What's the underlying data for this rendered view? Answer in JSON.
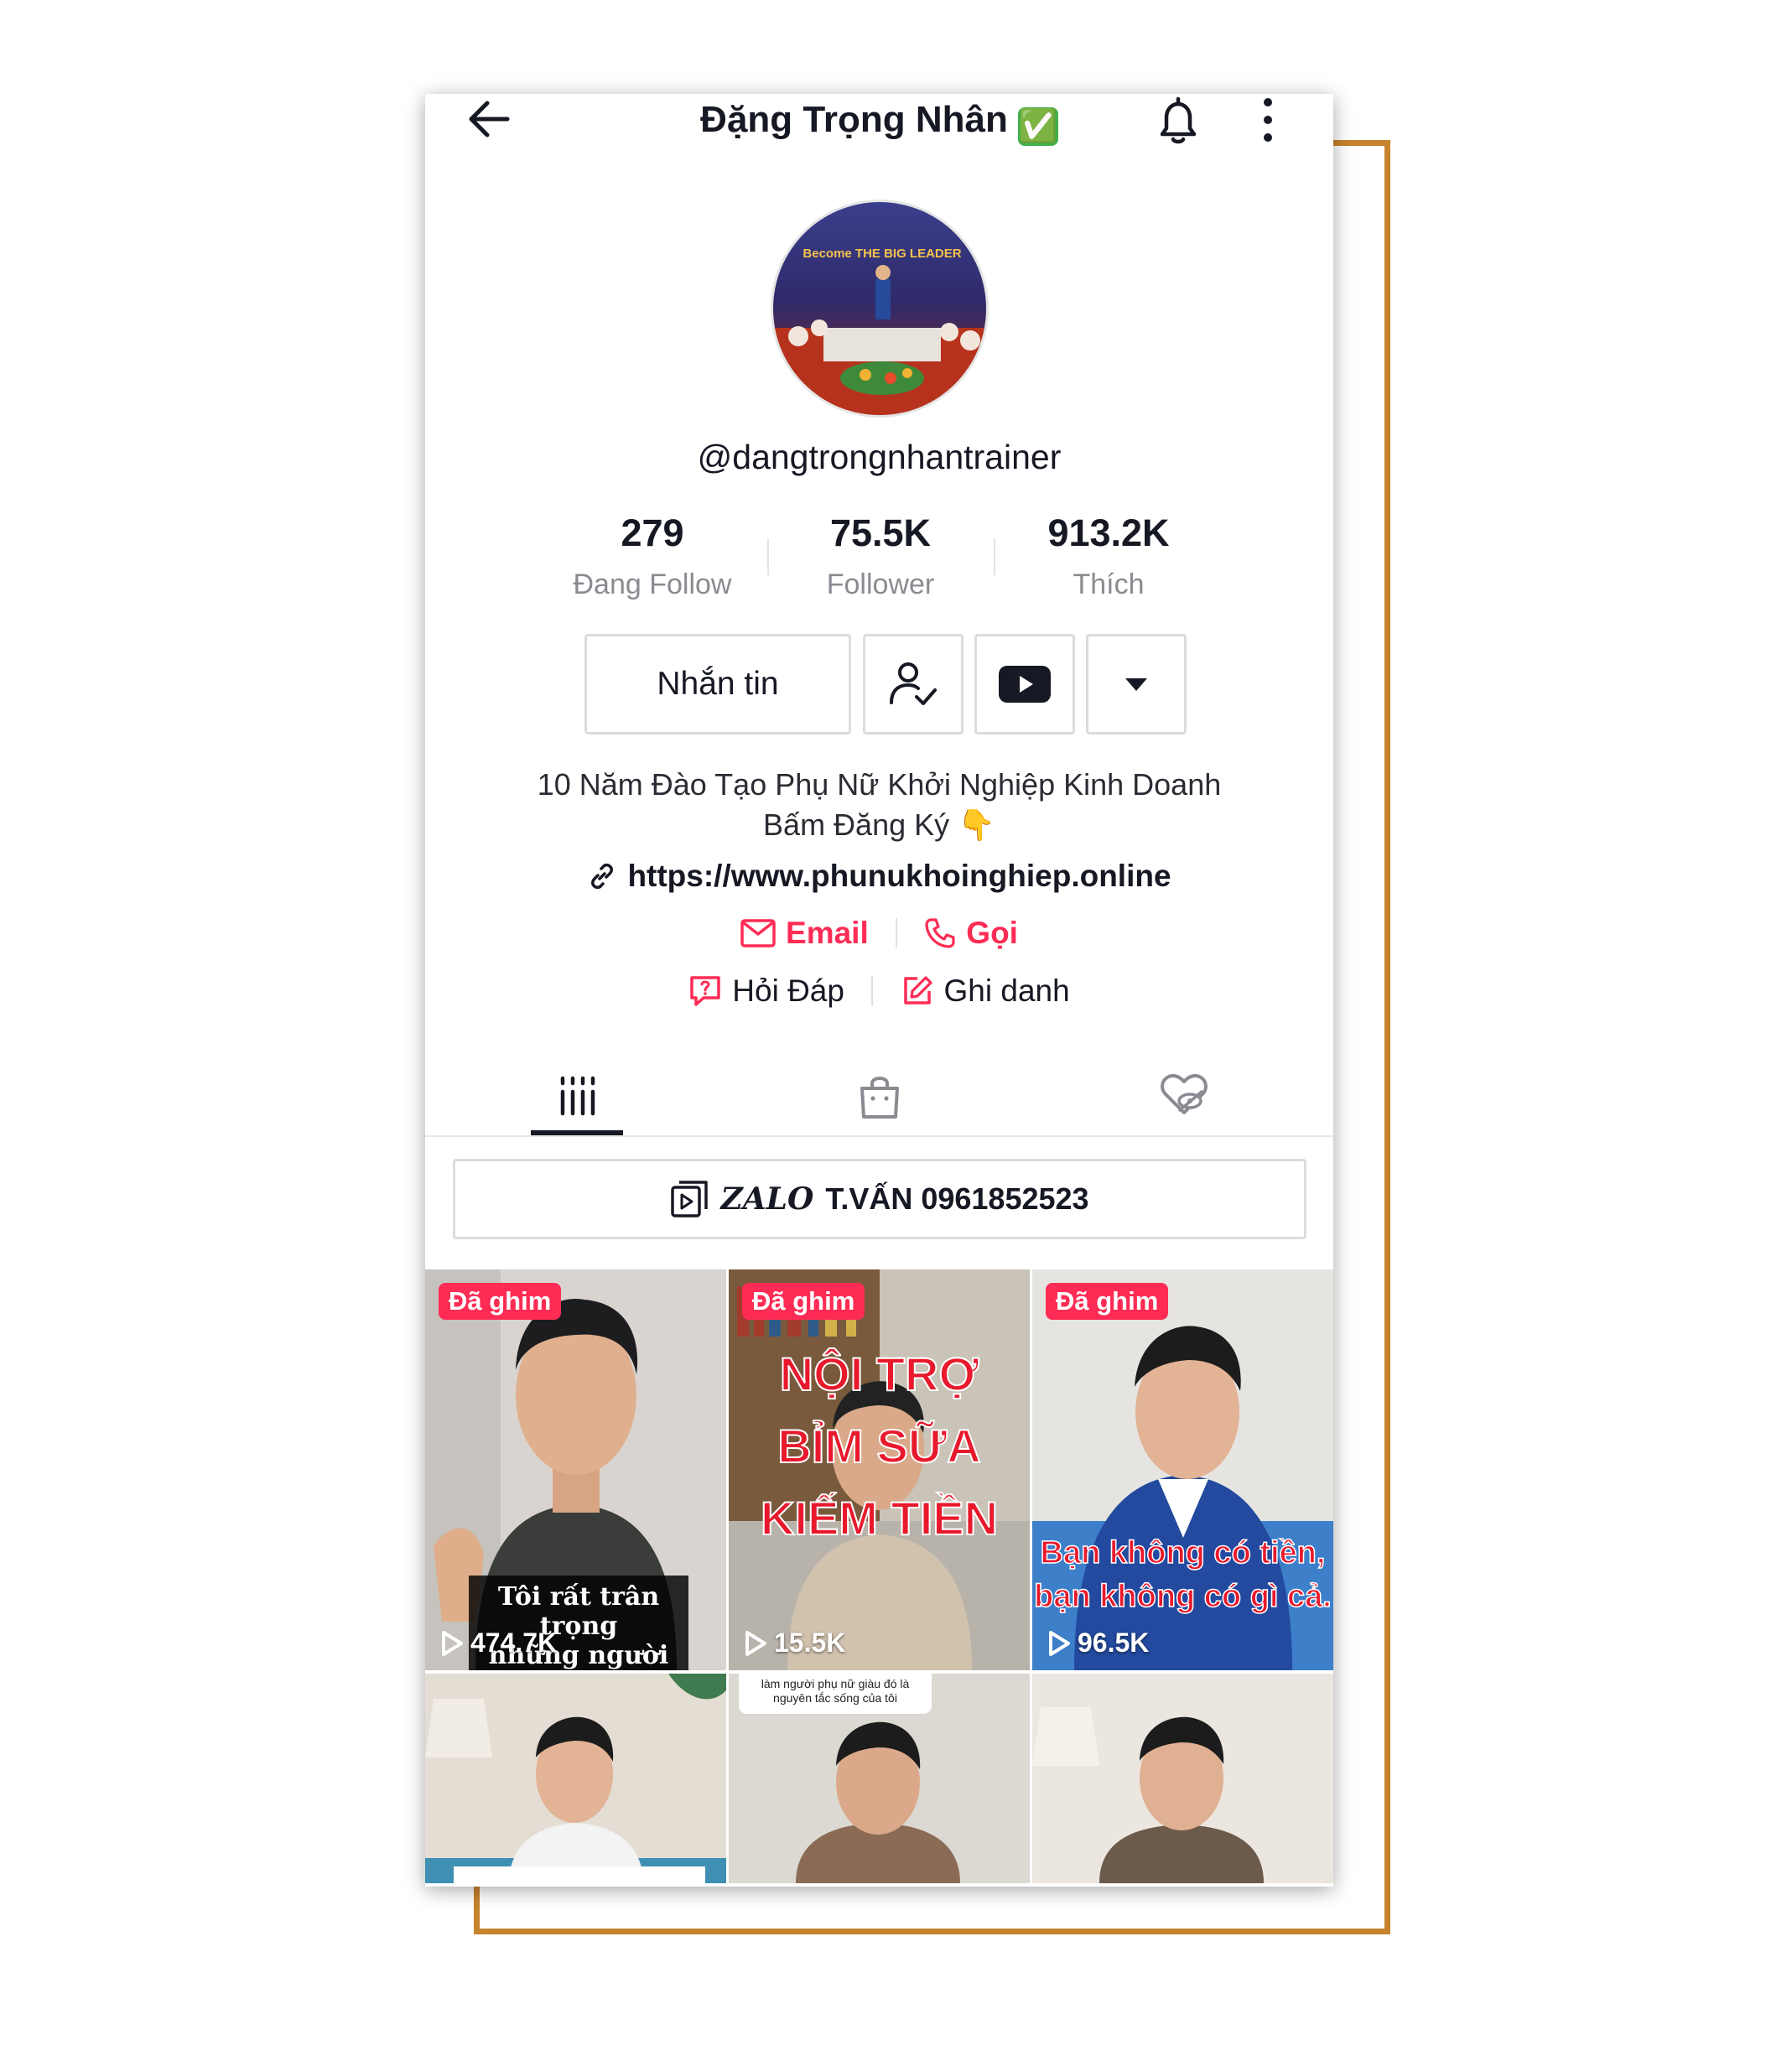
{
  "header": {
    "title": "Đặng Trọng Nhân",
    "verified_badge": "✅",
    "back_icon": "arrow-left-icon",
    "bell_icon": "bell-icon",
    "more_icon": "more-vertical-icon"
  },
  "profile": {
    "username": "@dangtrongnhantrainer",
    "avatar_banner_text": "Become THE BIG LEADER"
  },
  "stats": [
    {
      "value": "279",
      "label": "Đang Follow"
    },
    {
      "value": "75.5K",
      "label": "Follower"
    },
    {
      "value": "913.2K",
      "label": "Thích"
    }
  ],
  "actions": {
    "message_label": "Nhắn tin",
    "follow_icon": "user-check-icon",
    "youtube_icon": "youtube-icon",
    "dropdown_icon": "caret-down-icon"
  },
  "bio": {
    "line1": "10 Năm Đào Tạo Phụ Nữ Khởi Nghiệp Kinh Doanh",
    "line2": "Bấm Đăng Ký 👇",
    "link": "https://www.phunukhoinghiep.online"
  },
  "contacts": {
    "email_label": "Email",
    "call_label": "Gọi",
    "qa_label": "Hỏi Đáp",
    "register_label": "Ghi danh"
  },
  "tabs": [
    {
      "name": "videos",
      "icon": "grid-icon",
      "active": true
    },
    {
      "name": "shop",
      "icon": "shopping-bag-icon",
      "active": false
    },
    {
      "name": "liked",
      "icon": "hidden-heart-icon",
      "active": false
    }
  ],
  "zalo": {
    "script_text": "ZALO",
    "text": "T.VẤN 0961852523"
  },
  "videos": [
    {
      "pinned_label": "Đã ghim",
      "views": "474.7K",
      "caption": "Tôi rất trân trọng",
      "caption2": "những người phụ nữ"
    },
    {
      "pinned_label": "Đã ghim",
      "views": "15.5K",
      "caption_lines": [
        "NỘI TRỢ",
        "BỈM SỮA",
        "KIẾM TIỀN"
      ]
    },
    {
      "pinned_label": "Đã ghim",
      "views": "96.5K",
      "caption_lines": [
        "Bạn không có tiền,",
        "bạn không có gì cả."
      ]
    },
    {},
    {
      "bubble": "làm người phụ nữ giàu đó là nguyên tắc sống của tôi"
    },
    {}
  ],
  "colors": {
    "accent": "#fe2c55",
    "frame": "#c7832d",
    "text": "#161823",
    "muted": "#8a8b91"
  }
}
